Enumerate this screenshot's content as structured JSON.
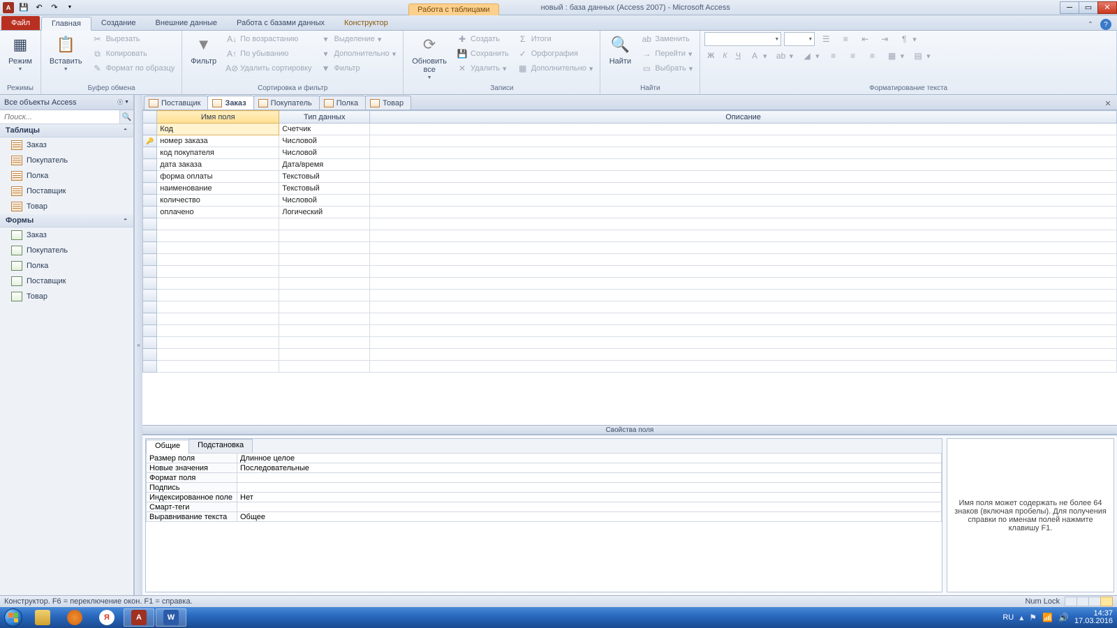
{
  "titlebar": {
    "context_label": "Работа с таблицами",
    "title": "новый : база данных (Access 2007)  -  Microsoft Access"
  },
  "ribbon_tabs": {
    "file": "Файл",
    "tabs": [
      "Главная",
      "Создание",
      "Внешние данные",
      "Работа с базами данных",
      "Конструктор"
    ],
    "active": 0
  },
  "ribbon": {
    "views": {
      "mode": "Режим",
      "label": "Режимы"
    },
    "clipboard": {
      "paste": "Вставить",
      "cut": "Вырезать",
      "copy": "Копировать",
      "format": "Формат по образцу",
      "label": "Буфер обмена"
    },
    "sort": {
      "filter": "Фильтр",
      "asc": "По возрастанию",
      "desc": "По убыванию",
      "clear": "Удалить сортировку",
      "sel": "Выделение",
      "adv": "Дополнительно",
      "tog": "Фильтр",
      "label": "Сортировка и фильтр"
    },
    "records": {
      "refresh": "Обновить\nвсе",
      "new": "Создать",
      "save": "Сохранить",
      "del": "Удалить",
      "totals": "Итоги",
      "spell": "Орфография",
      "more": "Дополнительно",
      "label": "Записи"
    },
    "find": {
      "find": "Найти",
      "replace": "Заменить",
      "goto": "Перейти",
      "select": "Выбрать",
      "label": "Найти"
    },
    "format": {
      "label": "Форматирование текста"
    }
  },
  "nav": {
    "header": "Все объекты Access",
    "search_ph": "Поиск...",
    "groups": [
      {
        "name": "Таблицы",
        "type": "table",
        "items": [
          "Заказ",
          "Покупатель",
          "Полка",
          "Поставщик",
          "Товар"
        ]
      },
      {
        "name": "Формы",
        "type": "form",
        "items": [
          "Заказ",
          "Покупатель",
          "Полка",
          "Поставщик",
          "Товар"
        ]
      }
    ]
  },
  "doc_tabs": {
    "tabs": [
      "Поставщик",
      "Заказ",
      "Покупатель",
      "Полка",
      "Товар"
    ],
    "active": 1
  },
  "design": {
    "headers": {
      "name": "Имя поля",
      "type": "Тип данных",
      "desc": "Описание"
    },
    "rows": [
      {
        "name": "Код",
        "type": "Счетчик",
        "active": true,
        "key": false
      },
      {
        "name": "номер заказа",
        "type": "Числовой",
        "key": true
      },
      {
        "name": "код покупателя",
        "type": "Числовой"
      },
      {
        "name": "дата заказа",
        "type": "Дата/время"
      },
      {
        "name": "форма оплаты",
        "type": "Текстовый"
      },
      {
        "name": "наименование",
        "type": "Текстовый"
      },
      {
        "name": "количество",
        "type": "Числовой"
      },
      {
        "name": "оплачено",
        "type": "Логический"
      }
    ]
  },
  "props": {
    "split": "Свойства поля",
    "tabs": [
      "Общие",
      "Подстановка"
    ],
    "active": 0,
    "rows": [
      {
        "k": "Размер поля",
        "v": "Длинное целое"
      },
      {
        "k": "Новые значения",
        "v": "Последовательные"
      },
      {
        "k": "Формат поля",
        "v": ""
      },
      {
        "k": "Подпись",
        "v": ""
      },
      {
        "k": "Индексированное поле",
        "v": "Нет"
      },
      {
        "k": "Смарт-теги",
        "v": ""
      },
      {
        "k": "Выравнивание текста",
        "v": "Общее"
      }
    ],
    "help": "Имя поля может содержать не более 64 знаков (включая пробелы). Для получения справки по именам полей нажмите клавишу F1."
  },
  "status": {
    "text": "Конструктор.   F6 = переключение окон.   F1 = справка.",
    "numlock": "Num Lock"
  },
  "tray": {
    "lang": "RU",
    "time": "14:37",
    "date": "17.03.2016"
  }
}
